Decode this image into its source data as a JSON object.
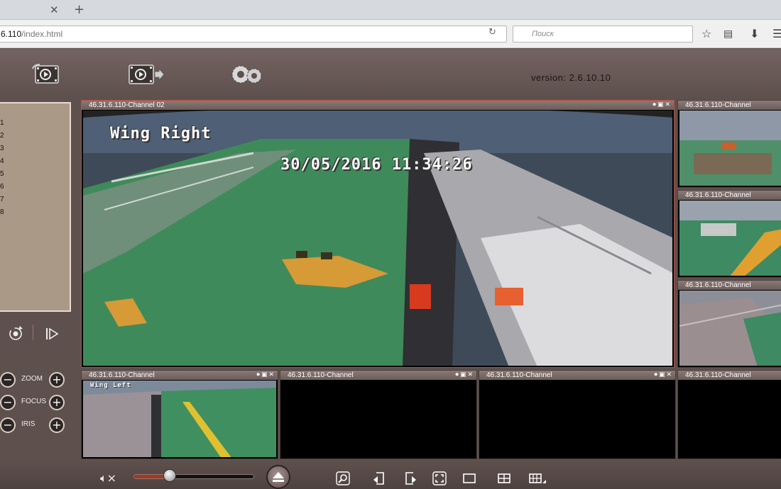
{
  "browser": {
    "url_host": "6.110",
    "url_path": "/index.html",
    "search_placeholder": "Поиск"
  },
  "header": {
    "version": "version: 2.6.10.10"
  },
  "sidebar": {
    "channel_numbers": [
      "1",
      "2",
      "3",
      "4",
      "5",
      "6",
      "7",
      "8"
    ],
    "ptz": {
      "zoom_label": "ZOOM",
      "focus_label": "FOCUS",
      "iris_label": "IRIS"
    }
  },
  "panes": {
    "main": {
      "title": "46.31.6.110-Channel 02",
      "osd_label": "Wing Right",
      "osd_timestamp": "30/05/2016 11:34:26"
    },
    "side1": {
      "title": "46.31.6.110-Channel"
    },
    "side2": {
      "title": "46.31.6.110-Channel"
    },
    "side3": {
      "title": "46.31.6.110-Channel"
    },
    "bottom1": {
      "title": "46.31.6.110-Channel",
      "osd_label": "Wing Left"
    },
    "bottom2": {
      "title": "46.31.6.110-Channel"
    },
    "bottom3": {
      "title": "46.31.6.110-Channel"
    },
    "bottom4": {
      "title": "46.31.6.110-Channel"
    }
  },
  "controls": {
    "volume_level": 0.3
  },
  "colors": {
    "background": "#5e504d",
    "active_border": "#c24a3a",
    "sidebar_list_bg": "#ab9987",
    "volume_fill": "#a6361e"
  },
  "icons": {
    "header": [
      "playback-film-icon",
      "record-film-icon",
      "settings-gears-icon"
    ],
    "toolbar": [
      "mute-icon",
      "eject-icon",
      "search-zoom-icon",
      "prev-icon",
      "next-icon",
      "fullscreen-icon",
      "layout-1-icon",
      "layout-4-icon",
      "layout-more-icon"
    ]
  }
}
